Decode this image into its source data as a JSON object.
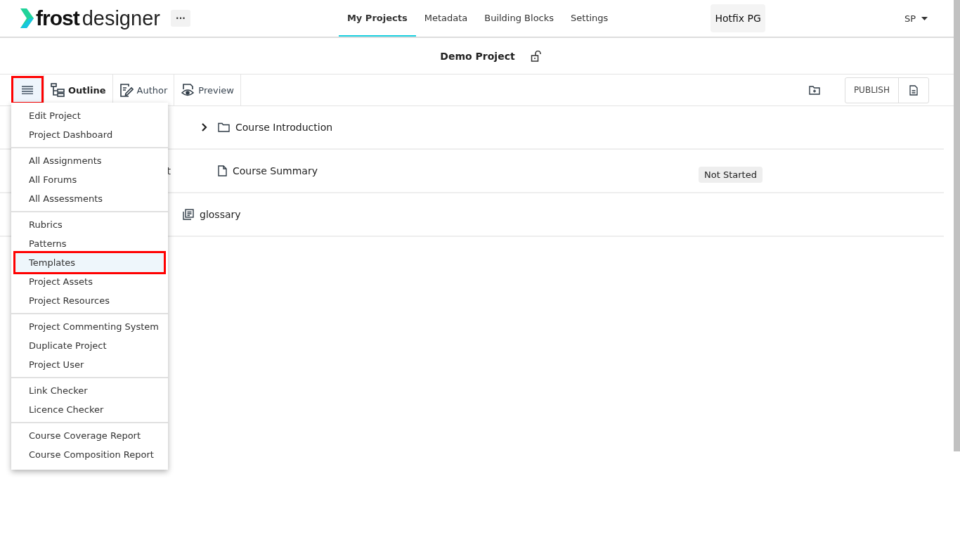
{
  "header": {
    "logo_bold": "frost",
    "logo_light": "designer",
    "more": "···",
    "nav": [
      {
        "label": "My Projects",
        "selected": true
      },
      {
        "label": "Metadata",
        "selected": false
      },
      {
        "label": "Building Blocks",
        "selected": false
      },
      {
        "label": "Settings",
        "selected": false
      }
    ],
    "environment": "Hotfix PG",
    "user": "SP"
  },
  "project": {
    "title": "Demo Project",
    "locked": false
  },
  "toolbar": {
    "menu_button": {
      "highlighted": true
    },
    "views": [
      {
        "label": "Outline",
        "selected": true,
        "kind": "outline"
      },
      {
        "label": "Author",
        "selected": false,
        "kind": "author"
      },
      {
        "label": "Preview",
        "selected": false,
        "kind": "preview"
      }
    ],
    "publish": "PUBLISH"
  },
  "outline": [
    {
      "kind": "folder",
      "title": "Course Introduction",
      "expandable": true
    },
    {
      "kind": "page",
      "title": "Course Summary",
      "expandable": false,
      "hidden_prefix": "t",
      "status": "Not Started"
    },
    {
      "kind": "glossary",
      "title": "glossary",
      "expandable": false
    }
  ],
  "menu": {
    "groups": [
      [
        {
          "label": "Edit Project",
          "selected": false
        },
        {
          "label": "Project Dashboard",
          "selected": false
        }
      ],
      [
        {
          "label": "All Assignments",
          "selected": false
        },
        {
          "label": "All Forums",
          "selected": false
        },
        {
          "label": "All Assessments",
          "selected": false
        }
      ],
      [
        {
          "label": "Rubrics",
          "selected": false
        },
        {
          "label": "Patterns",
          "selected": false
        },
        {
          "label": "Templates",
          "selected": true
        },
        {
          "label": "Project Assets",
          "selected": false
        },
        {
          "label": "Project Resources",
          "selected": false
        }
      ],
      [
        {
          "label": "Project Commenting System",
          "selected": false
        },
        {
          "label": "Duplicate Project",
          "selected": false
        },
        {
          "label": "Project User",
          "selected": false
        }
      ],
      [
        {
          "label": "Link Checker",
          "selected": false
        },
        {
          "label": "Licence Checker",
          "selected": false
        }
      ],
      [
        {
          "label": "Course Coverage Report",
          "selected": false
        },
        {
          "label": "Course Composition Report",
          "selected": false
        }
      ]
    ]
  }
}
